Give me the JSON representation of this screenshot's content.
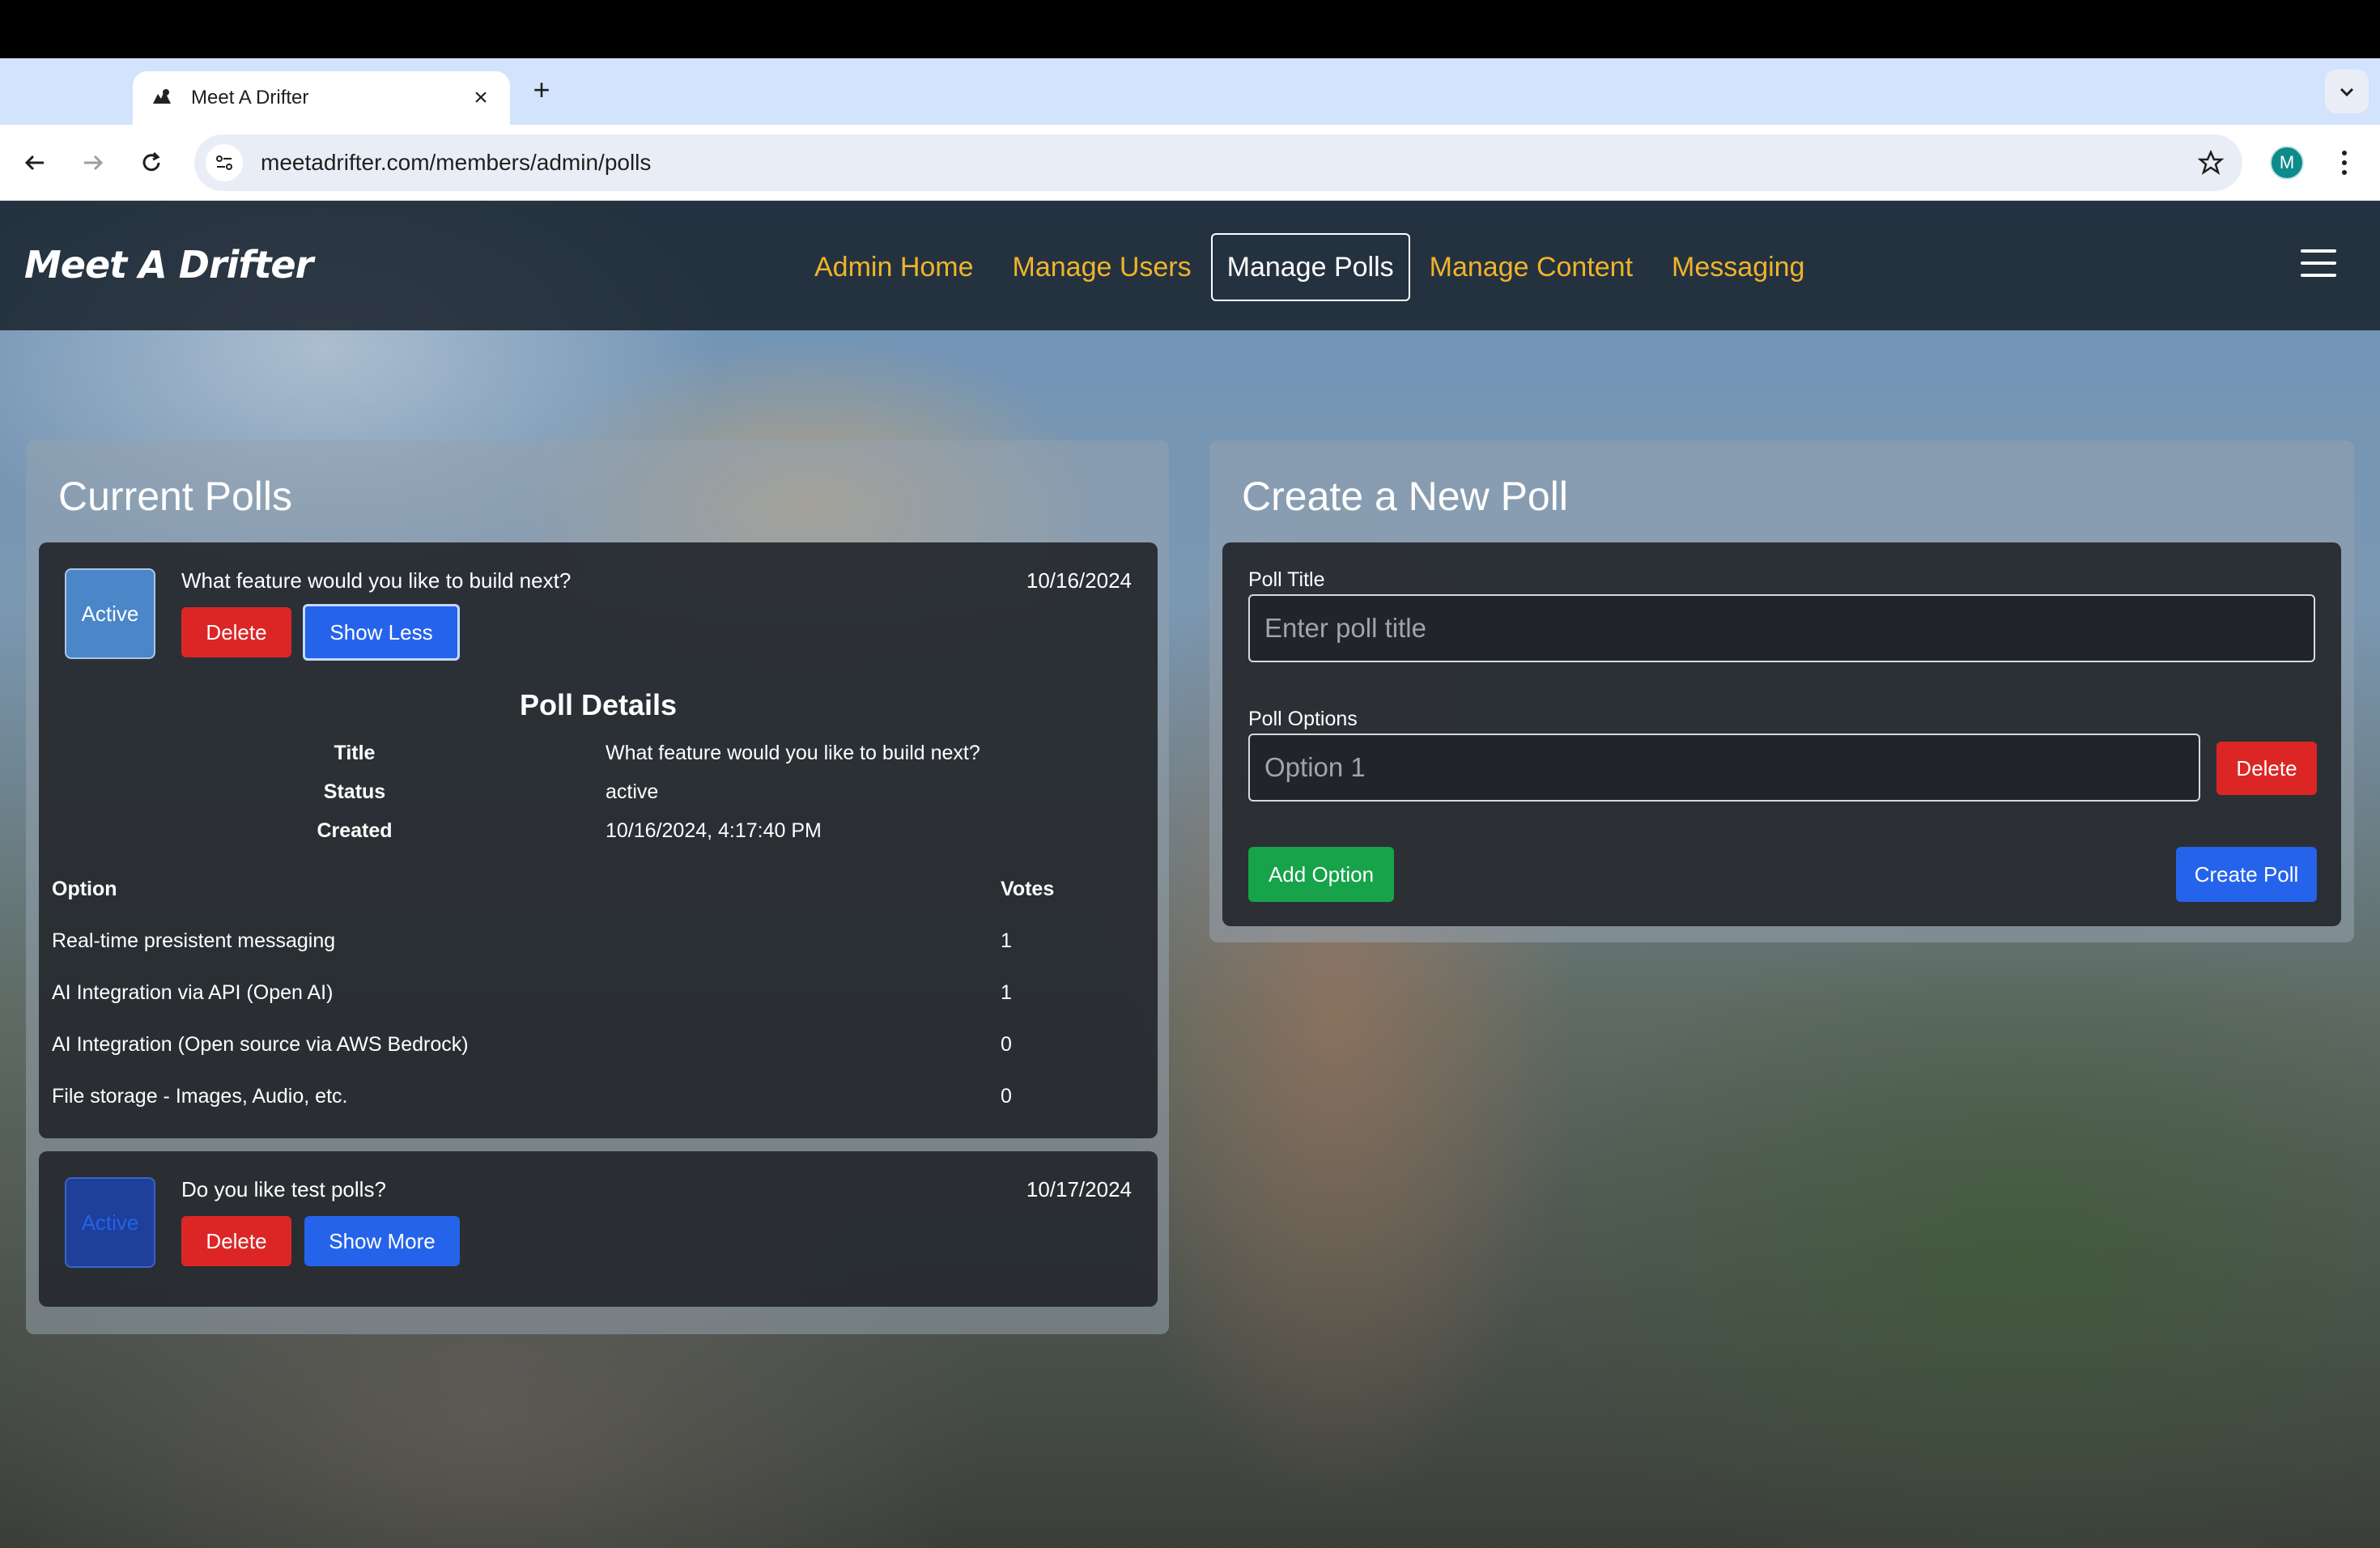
{
  "browser": {
    "tab_title": "Meet A Drifter",
    "url": "meetadrifter.com/members/admin/polls",
    "profile_initial": "M"
  },
  "nav": {
    "brand": "Meet A Drifter",
    "links": [
      "Admin Home",
      "Manage Users",
      "Manage Polls",
      "Manage Content",
      "Messaging"
    ],
    "active": "Manage Polls"
  },
  "current_polls": {
    "title": "Current Polls",
    "polls": [
      {
        "status_badge": "Active",
        "question": "What feature would you like to build next?",
        "date": "10/16/2024",
        "delete_label": "Delete",
        "toggle_label": "Show Less",
        "details": {
          "heading": "Poll Details",
          "rows": [
            {
              "label": "Title",
              "value": "What feature would you like to build next?"
            },
            {
              "label": "Status",
              "value": "active"
            },
            {
              "label": "Created",
              "value": "10/16/2024, 4:17:40 PM"
            }
          ],
          "option_header": "Option",
          "votes_header": "Votes",
          "options": [
            {
              "option": "Real-time presistent messaging",
              "votes": "1"
            },
            {
              "option": "AI Integration via API (Open AI)",
              "votes": "1"
            },
            {
              "option": "AI Integration (Open source via AWS Bedrock)",
              "votes": "0"
            },
            {
              "option": "File storage - Images, Audio, etc.",
              "votes": "0"
            }
          ]
        }
      },
      {
        "status_badge": "Active",
        "question": "Do you like test polls?",
        "date": "10/17/2024",
        "delete_label": "Delete",
        "toggle_label": "Show More"
      }
    ]
  },
  "create_poll": {
    "title": "Create a New Poll",
    "poll_title_label": "Poll Title",
    "poll_title_placeholder": "Enter poll title",
    "poll_options_label": "Poll Options",
    "option_placeholder": "Option 1",
    "delete_label": "Delete",
    "add_option_label": "Add Option",
    "create_label": "Create Poll"
  },
  "colors": {
    "nav_link": "#f0b429",
    "danger": "#dc2626",
    "primary": "#2563eb",
    "success": "#16a34a"
  }
}
